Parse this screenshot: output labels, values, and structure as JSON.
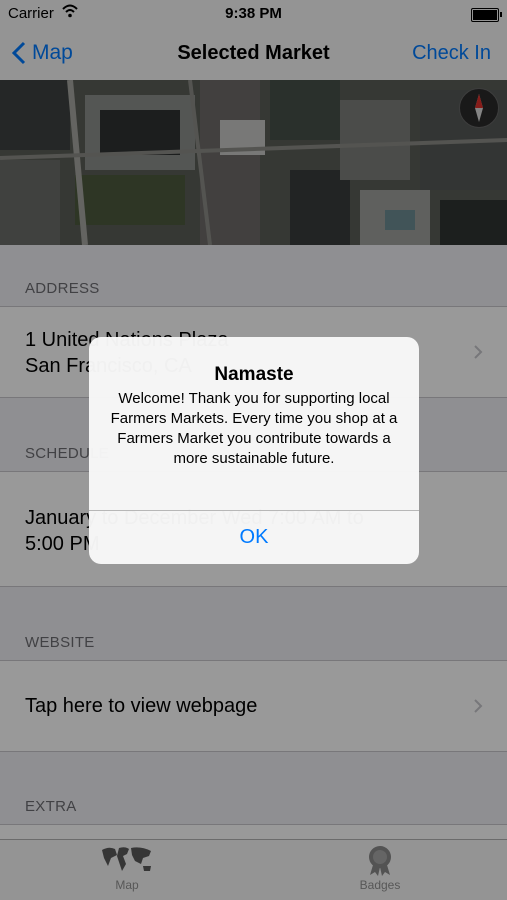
{
  "status_bar": {
    "carrier": "Carrier",
    "time": "9:38 PM"
  },
  "nav": {
    "back_label": "Map",
    "title": "Selected Market",
    "right_button": "Check In"
  },
  "sections": {
    "address": {
      "header": "ADDRESS",
      "line1": "1 United Nations Plaza",
      "line2": "San Francisco, CA"
    },
    "schedule": {
      "header": "SCHEDULE",
      "line1": "January to December Wed 7:00 AM to",
      "line2": "5:00 PM"
    },
    "website": {
      "header": "WEBSITE",
      "link_text": "Tap here to view webpage"
    },
    "extra": {
      "header": "EXTRA"
    }
  },
  "tab_bar": {
    "items": [
      {
        "label": "Map",
        "icon": "world-map-icon"
      },
      {
        "label": "Badges",
        "icon": "badge-icon"
      }
    ]
  },
  "alert": {
    "title": "Namaste",
    "message": "Welcome! Thank you for supporting local Farmers Markets. Every time you shop at a Farmers Market you contribute towards a more sustainable future.",
    "ok_label": "OK"
  },
  "colors": {
    "accent": "#007aff",
    "background": "#efeff4"
  }
}
